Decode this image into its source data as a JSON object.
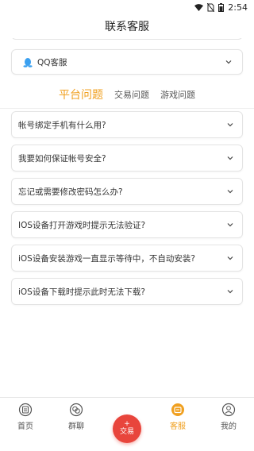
{
  "status_bar": {
    "time": "2:54",
    "icons": [
      "wifi-icon",
      "no-sim-icon",
      "battery-icon"
    ]
  },
  "header": {
    "title": "联系客服"
  },
  "qq_service": {
    "label": "QQ客服",
    "icon": "qq-penguin-icon"
  },
  "tabs": [
    {
      "label": "平台问题",
      "active": true
    },
    {
      "label": "交易问题",
      "active": false
    },
    {
      "label": "游戏问题",
      "active": false
    }
  ],
  "faq": [
    {
      "question": "帐号绑定手机有什么用?"
    },
    {
      "question": "我要如何保证帐号安全?"
    },
    {
      "question": "忘记或需要修改密码怎么办?"
    },
    {
      "question": "IOS设备打开游戏时提示无法验证?"
    },
    {
      "question": "iOS设备安装游戏一直显示等待中，不自动安装?"
    },
    {
      "question": "iOS设备下载时提示此时无法下载?"
    }
  ],
  "bottom_nav": {
    "items": [
      {
        "label": "首页",
        "icon": "home-icon"
      },
      {
        "label": "群聊",
        "icon": "chat-icon"
      },
      {
        "label": "交易",
        "icon": "plus-icon"
      },
      {
        "label": "客服",
        "icon": "service-icon",
        "active": true
      },
      {
        "label": "我的",
        "icon": "profile-icon"
      }
    ]
  },
  "colors": {
    "accent": "#f0a020",
    "trade_button": "#e8453c",
    "qq_blue": "#3aa0f0"
  }
}
